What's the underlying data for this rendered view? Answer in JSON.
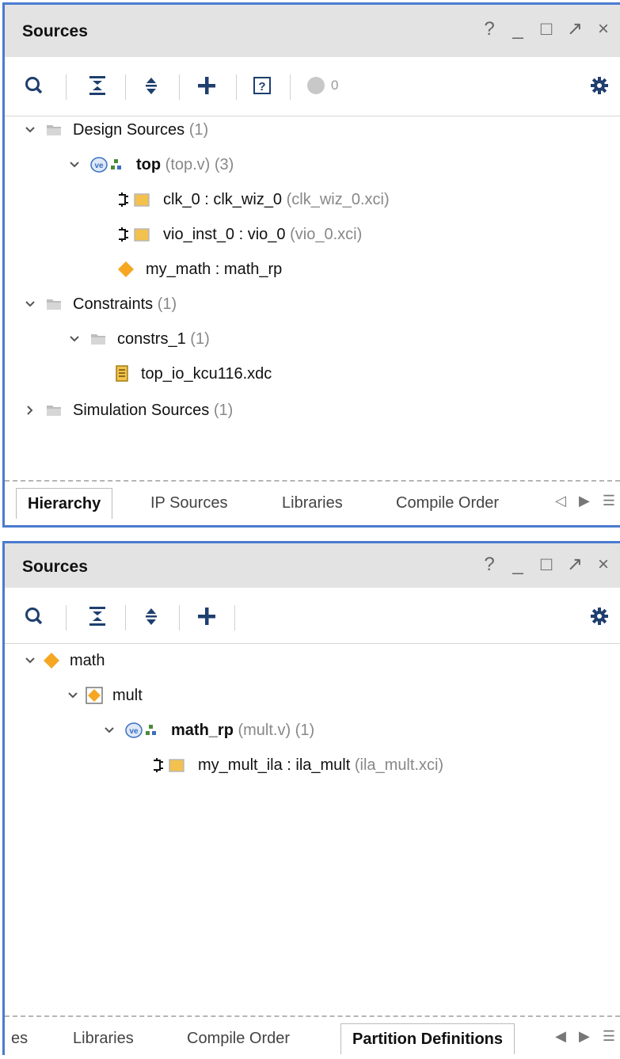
{
  "panel1": {
    "title": "Sources",
    "window_controls": [
      "?",
      "_",
      "□",
      "↗",
      "×"
    ],
    "badge_count": "0",
    "tree": [
      {
        "label": "Design Sources",
        "meta": "(1)",
        "bold": false,
        "icon": "folder-icon"
      },
      {
        "label": "top",
        "meta": "(top.v) (3)",
        "bold": true,
        "icon": "verilog-module-icon"
      },
      {
        "label": "clk_0 : clk_wiz_0",
        "meta": "(clk_wiz_0.xci)",
        "bold": false,
        "icon": "ip-core-icon"
      },
      {
        "label": "vio_inst_0 : vio_0",
        "meta": "(vio_0.xci)",
        "bold": false,
        "icon": "ip-core-icon"
      },
      {
        "label": "my_math : math_rp",
        "meta": "",
        "bold": false,
        "icon": "partition-icon"
      },
      {
        "label": "Constraints",
        "meta": "(1)",
        "bold": false,
        "icon": "folder-icon"
      },
      {
        "label": "constrs_1",
        "meta": "(1)",
        "bold": false,
        "icon": "folder-icon"
      },
      {
        "label": "top_io_kcu116.xdc",
        "meta": "",
        "bold": false,
        "icon": "constraint-file-icon"
      },
      {
        "label": "Simulation Sources",
        "meta": "(1)",
        "bold": false,
        "icon": "folder-icon"
      }
    ],
    "tabs": [
      "Hierarchy",
      "IP Sources",
      "Libraries",
      "Compile Order"
    ],
    "active_tab": "Hierarchy"
  },
  "panel2": {
    "title": "Sources",
    "window_controls": [
      "?",
      "_",
      "□",
      "↗",
      "×"
    ],
    "tree": [
      {
        "label": "math",
        "meta": "",
        "bold": false,
        "icon": "partition-icon"
      },
      {
        "label": "mult",
        "meta": "",
        "bold": false,
        "icon": "partition-def-icon"
      },
      {
        "label": "math_rp",
        "meta": "(mult.v) (1)",
        "bold": true,
        "icon": "verilog-module-icon"
      },
      {
        "label": "my_mult_ila : ila_mult",
        "meta": "(ila_mult.xci)",
        "bold": false,
        "icon": "ip-core-icon"
      }
    ],
    "tabs": [
      "es",
      "Libraries",
      "Compile Order",
      "Partition Definitions"
    ],
    "active_tab": "Partition Definitions"
  },
  "colors": {
    "accent_border": "#4a7bd0",
    "diamond": "#f5a623",
    "folder": "#bdbdbd"
  }
}
